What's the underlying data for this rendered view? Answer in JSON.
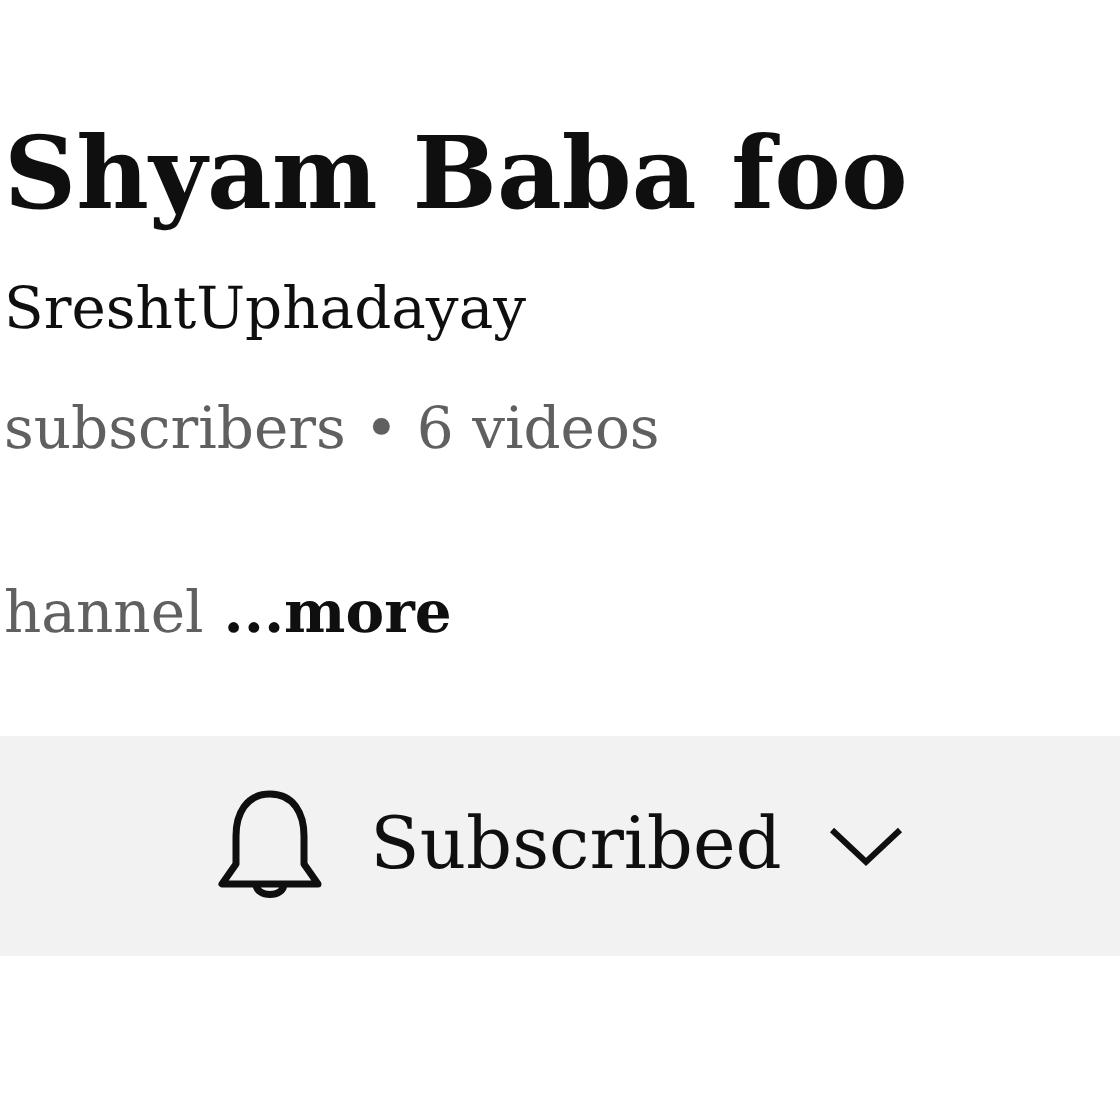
{
  "channel": {
    "title": "Shyam Baba foo",
    "handle": "SreshtUphadayay",
    "stats": "subscribers • 6 videos",
    "description": "hannel",
    "more_link": "...more"
  },
  "subscribe_button": {
    "label": "Subscribed"
  }
}
